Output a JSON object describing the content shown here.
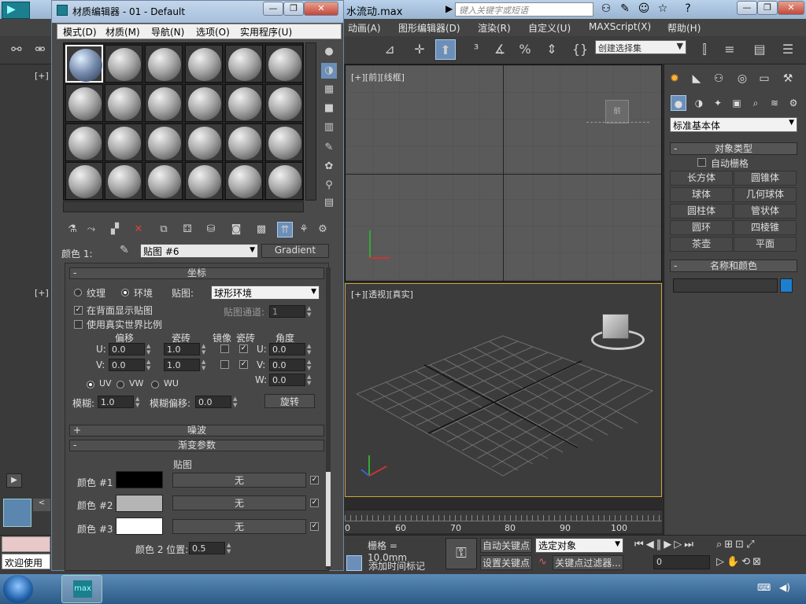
{
  "window": {
    "file_title": "水流动.max",
    "search_placeholder": "键入关键字或短语"
  },
  "menubar": {
    "items": [
      "动画(A)",
      "图形编辑器(D)",
      "渲染(R)",
      "自定义(U)",
      "MAXScript(X)",
      "帮助(H)"
    ]
  },
  "toolbar": {
    "selection_set": "创建选择集"
  },
  "viewports": {
    "top_left_label": "[+]",
    "front_label": "[+][前][线框]",
    "left_label": "[+]",
    "persp_label": "[+][透视][真实]",
    "ruler_ticks": [
      "0",
      "60",
      "70",
      "80",
      "90",
      "100"
    ]
  },
  "command_panel": {
    "category": "标准基本体",
    "object_type_header": "对象类型",
    "auto_grid": "自动栅格",
    "objects": [
      "长方体",
      "圆锥体",
      "球体",
      "几何球体",
      "圆柱体",
      "管状体",
      "圆环",
      "四棱锥",
      "茶壶",
      "平面"
    ],
    "name_color_header": "名称和颜色",
    "object_color": "#1e7fd0"
  },
  "bottom": {
    "grid": "栅格 = 10.0mm",
    "auto_key": "自动关键点",
    "set_key": "设置关键点",
    "selected_object": "选定对象",
    "key_filter": "关键点过滤器...",
    "add_time_tag": "添加时间标记",
    "frame": "0",
    "welcome": "欢迎使用"
  },
  "material_editor": {
    "title": "材质编辑器 - 01 - Default",
    "menus": [
      "模式(D)",
      "材质(M)",
      "导航(N)",
      "选项(O)",
      "实用程序(U)"
    ],
    "color_label": "颜色 1:",
    "map_name": "贴图 #6",
    "map_type": "Gradient",
    "coords": {
      "header": "坐标",
      "texture": "纹理",
      "environ": "环境",
      "mapping_label": "贴图:",
      "mapping": "球形环境",
      "show_back": "在背面显示贴图",
      "map_channel_label": "贴图通道:",
      "map_channel": "1",
      "real_world": "使用真实世界比例",
      "offset": "偏移",
      "tiling": "瓷砖",
      "mirror": "镜像",
      "tile": "瓷砖",
      "angle": "角度",
      "u_label": "U:",
      "v_label": "V:",
      "w_label": "W:",
      "u_offset": "0.0",
      "v_offset": "0.0",
      "u_tiling": "1.0",
      "v_tiling": "1.0",
      "u_angle": "0.0",
      "v_angle": "0.0",
      "w_angle": "0.0",
      "uv": "UV",
      "vw": "VW",
      "wu": "WU",
      "blur_label": "模糊:",
      "blur": "1.0",
      "blur_offset_label": "模糊偏移:",
      "blur_offset": "0.0",
      "rotate": "旋转"
    },
    "noise_header": "噪波",
    "gradient": {
      "header": "渐变参数",
      "maps_header": "贴图",
      "colors": [
        {
          "label": "颜色 #1",
          "swatch": "#000000",
          "map": "无"
        },
        {
          "label": "颜色 #2",
          "swatch": "#b4b4b4",
          "map": "无"
        },
        {
          "label": "颜色 #3",
          "swatch": "#ffffff",
          "map": "无"
        }
      ],
      "pos_label": "颜色 2 位置:",
      "pos": "0.5"
    }
  }
}
